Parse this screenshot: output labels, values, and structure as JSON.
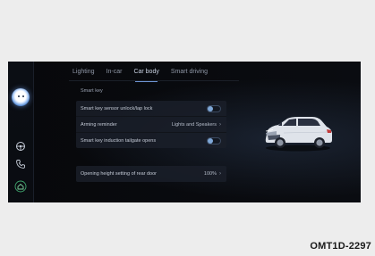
{
  "tabs": [
    {
      "label": "Lighting",
      "active": false
    },
    {
      "label": "In-car",
      "active": false
    },
    {
      "label": "Car body",
      "active": true
    },
    {
      "label": "Smart driving",
      "active": false
    }
  ],
  "section": {
    "title": "Smart key"
  },
  "smart_key_rows": [
    {
      "label": "Smart key sensor unlock/lap lock",
      "control": "toggle",
      "state": "off"
    },
    {
      "label": "Arming reminder",
      "control": "value",
      "value": "Lights and Speakers"
    },
    {
      "label": "Smart key induction tailgate opens",
      "control": "toggle",
      "state": "off"
    }
  ],
  "tailgate": {
    "label": "Opening height setting of rear door",
    "value": "100%"
  },
  "caption": "OMT1D-2297",
  "sidebar_icons": [
    "assistant-avatar-icon",
    "steering-icon",
    "phone-icon",
    "home-icon"
  ],
  "colors": {
    "accent": "#6e95d4",
    "background": "#07080b",
    "panel": "#1a1f29",
    "page": "#ededed"
  }
}
